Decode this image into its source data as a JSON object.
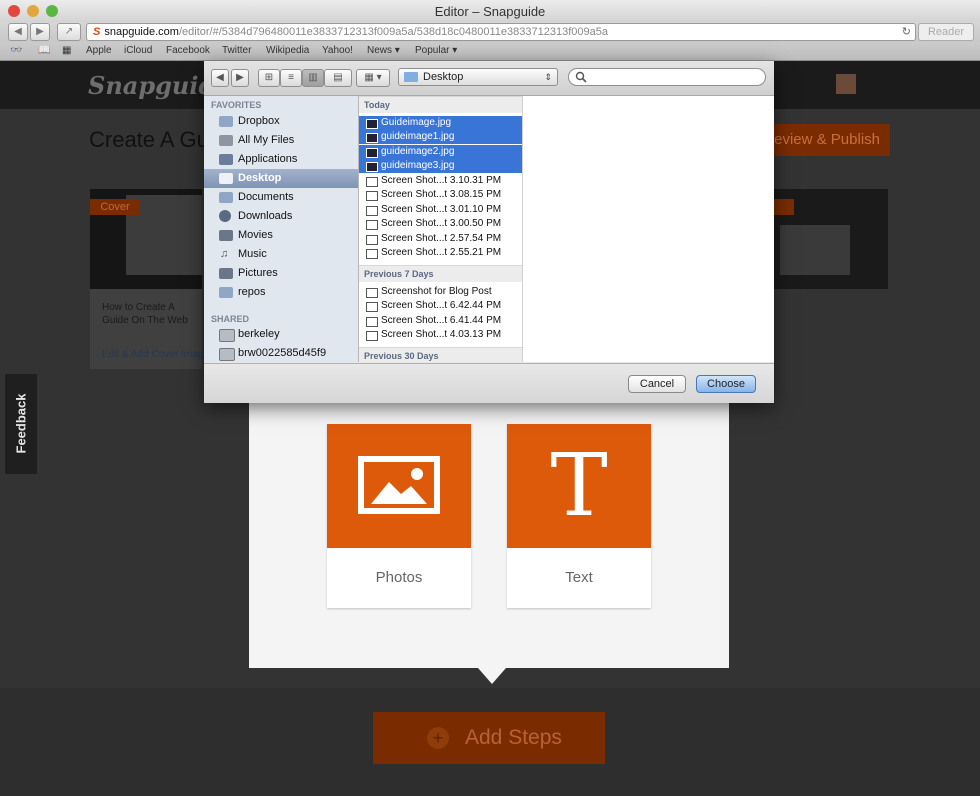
{
  "window": {
    "title": "Editor – Snapguide"
  },
  "browser": {
    "url_domain": "snapguide.com",
    "url_path": "/editor/#/5384d796480011e3833712313f009a5a/538d18c0480011e3833712313f009a5a",
    "reader_label": "Reader",
    "bookmarks": [
      "Apple",
      "iCloud",
      "Facebook",
      "Twitter",
      "Wikipedia",
      "Yahoo!",
      "News ▾",
      "Popular ▾"
    ]
  },
  "site": {
    "logo": "Snapguide",
    "page_title": "Create A Guid",
    "review_publish": "eview & Publish",
    "cover_badge": "Cover",
    "card_title": "How to Create A Guide On The Web",
    "card_link": "Edit & Add Cover Imag",
    "feedback": "Feedback",
    "tiles": [
      {
        "label": "Photos"
      },
      {
        "label": "Text",
        "glyph": "T"
      }
    ],
    "add_steps": "Add Steps",
    "add_plus": "+",
    "accent_color": "#de5a0b"
  },
  "dialog": {
    "location": "Desktop",
    "sidebar": {
      "favorites_header": "FAVORITES",
      "favorites": [
        "Dropbox",
        "All My Files",
        "Applications",
        "Desktop",
        "Documents",
        "Downloads",
        "Movies",
        "Music",
        "Pictures",
        "repos"
      ],
      "shared_header": "SHARED",
      "shared": [
        "berkeley",
        "brw0022585d45f9"
      ]
    },
    "groups": [
      {
        "label": "Today",
        "files": [
          "Guideimage.jpg",
          "guideimage1.jpg",
          "guideimage2.jpg",
          "guideimage3.jpg",
          "Screen Shot...t 3.10.31 PM",
          "Screen Shot...t 3.08.15 PM",
          "Screen Shot...t 3.01.10 PM",
          "Screen Shot...t 3.00.50 PM",
          "Screen Shot...t 2.57.54 PM",
          "Screen Shot...t 2.55.21 PM"
        ]
      },
      {
        "label": "Previous 7 Days",
        "files": [
          "Screenshot for Blog Post",
          "Screen Shot...t 6.42.44 PM",
          "Screen Shot...t 6.41.44 PM",
          "Screen Shot...t 4.03.13 PM"
        ]
      },
      {
        "label": "Previous 30 Days",
        "files": []
      }
    ],
    "cancel": "Cancel",
    "choose": "Choose"
  }
}
